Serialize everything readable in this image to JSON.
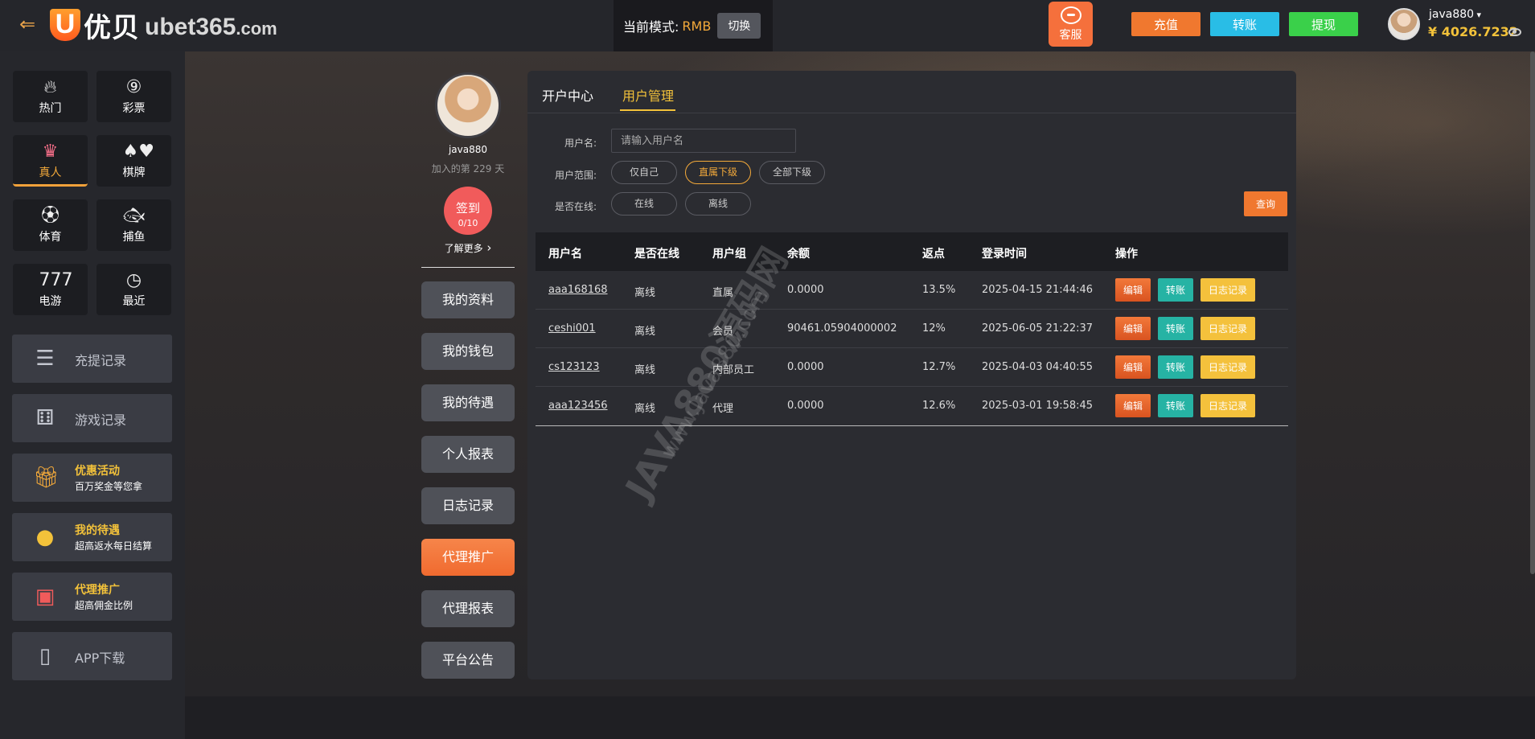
{
  "header": {
    "brand_cn": "优贝",
    "brand_en": "ubet365",
    "brand_tld": ".com",
    "mode_label": "当前模式:",
    "mode_value": "RMB",
    "mode_switch": "切换",
    "service_label": "客服",
    "deposit": "充值",
    "transfer": "转账",
    "withdraw": "提现",
    "username": "java880",
    "balance": "¥ 4026.7232"
  },
  "sidebar": {
    "games": [
      {
        "label": "热门",
        "icon": "fire-icon"
      },
      {
        "label": "彩票",
        "icon": "lottery-ball-icon"
      },
      {
        "label": "真人",
        "icon": "dealer-icon",
        "active": true
      },
      {
        "label": "棋牌",
        "icon": "cards-icon"
      },
      {
        "label": "体育",
        "icon": "soccer-ball-icon"
      },
      {
        "label": "捕鱼",
        "icon": "fish-icon"
      },
      {
        "label": "电游",
        "icon": "slot-777-icon"
      },
      {
        "label": "最近",
        "icon": "clock-icon"
      }
    ],
    "menu": [
      {
        "title": "充提记录",
        "icon": "coins-stack-icon"
      },
      {
        "title": "游戏记录",
        "icon": "dice-icon"
      },
      {
        "title": "优惠活动",
        "sub": "百万奖金等您拿",
        "icon": "gift-icon"
      },
      {
        "title": "我的待遇",
        "sub": "超高返水每日结算",
        "icon": "gold-coin-icon"
      },
      {
        "title": "代理推广",
        "sub": "超高佣金比例",
        "icon": "wallet-icon"
      },
      {
        "title": "APP下载",
        "icon": "phone-icon"
      }
    ]
  },
  "profile": {
    "name": "java880",
    "joined": "加入的第 229 天",
    "signin_title": "签到",
    "signin_count": "0/10",
    "learn_more": "了解更多",
    "nav": [
      "我的资料",
      "我的钱包",
      "我的待遇",
      "个人报表",
      "日志记录",
      "代理推广",
      "代理报表",
      "平台公告"
    ],
    "active_nav": 5
  },
  "panel": {
    "tabs": [
      "开户中心",
      "用户管理"
    ],
    "active_tab": 1,
    "filters": {
      "username_label": "用户名:",
      "username_placeholder": "请输入用户名",
      "range_label": "用户范围:",
      "range_options": [
        "仅自己",
        "直属下级",
        "全部下级"
      ],
      "range_selected": 1,
      "online_label": "是否在线:",
      "online_options": [
        "在线",
        "离线"
      ],
      "query": "查询"
    },
    "table": {
      "columns": [
        "用户名",
        "是否在线",
        "用户组",
        "余额",
        "返点",
        "登录时间",
        "操作"
      ],
      "rows": [
        {
          "username": "aaa168168",
          "online": "离线",
          "group": "直属",
          "balance": "0.0000",
          "rebate": "13.5%",
          "login": "2025-04-15 21:44:46"
        },
        {
          "username": "ceshi001",
          "online": "离线",
          "group": "会员",
          "balance": "90461.05904000002",
          "rebate": "12%",
          "login": "2025-06-05 21:22:37"
        },
        {
          "username": "cs123123",
          "online": "离线",
          "group": "内部员工",
          "balance": "0.0000",
          "rebate": "12.7%",
          "login": "2025-04-03 04:40:55"
        },
        {
          "username": "aaa123456",
          "online": "离线",
          "group": "代理",
          "balance": "0.0000",
          "rebate": "12.6%",
          "login": "2025-03-01 19:58:45"
        }
      ],
      "actions": [
        "编辑",
        "转账",
        "日志记录"
      ]
    }
  },
  "watermark": {
    "line1": "JAVA880源码网",
    "line2": "www.Java880.com"
  },
  "colors": {
    "accent": "#f3c23a",
    "orange": "#f0782f",
    "cyan": "#29bde6",
    "green": "#3ad04a"
  }
}
